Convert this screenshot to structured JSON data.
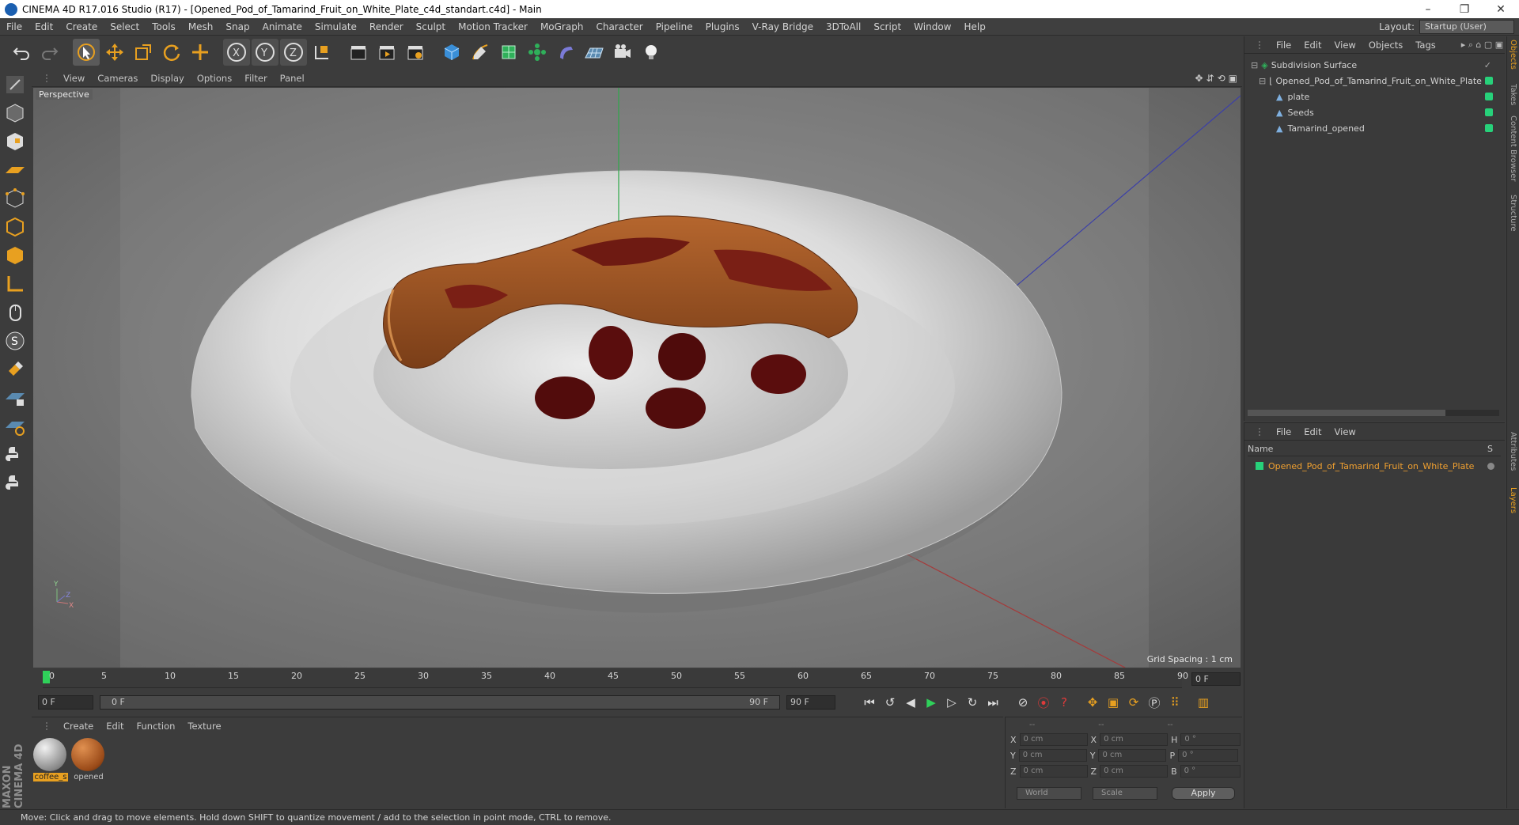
{
  "window": {
    "title": "CINEMA 4D R17.016 Studio (R17) - [Opened_Pod_of_Tamarind_Fruit_on_White_Plate_c4d_standart.c4d] - Main",
    "minimize": "–",
    "restore": "❐",
    "close": "✕"
  },
  "menubar": {
    "items": [
      "File",
      "Edit",
      "Create",
      "Select",
      "Tools",
      "Mesh",
      "Snap",
      "Animate",
      "Simulate",
      "Render",
      "Sculpt",
      "Motion Tracker",
      "MoGraph",
      "Character",
      "Pipeline",
      "Plugins",
      "V-Ray Bridge",
      "3DToAll",
      "Script",
      "Window",
      "Help"
    ],
    "layout_label": "Layout:",
    "layout_value": "Startup (User)"
  },
  "viewport": {
    "menu": [
      "View",
      "Cameras",
      "Display",
      "Options",
      "Filter",
      "Panel"
    ],
    "label": "Perspective",
    "grid_spacing": "Grid Spacing : 1 cm",
    "axis_x": "X",
    "axis_y": "Y",
    "axis_z": "Z"
  },
  "timeline": {
    "ticks": [
      "0",
      "5",
      "10",
      "15",
      "20",
      "25",
      "30",
      "35",
      "40",
      "45",
      "50",
      "55",
      "60",
      "65",
      "70",
      "75",
      "80",
      "85",
      "90"
    ],
    "current_frame": "0 F",
    "start_field": "0 F",
    "range_start": "0 F",
    "range_end": "90 F",
    "end_field": "90 F"
  },
  "materials": {
    "menu": [
      "Create",
      "Edit",
      "Function",
      "Texture"
    ],
    "items": [
      {
        "label": "coffee_s",
        "color": "#a9a9a9"
      },
      {
        "label": "opened",
        "color": "#b8642a"
      }
    ]
  },
  "coordinates": {
    "headers": [
      "--",
      "--",
      "--"
    ],
    "rows": [
      {
        "a": "X",
        "a_val": "0 cm",
        "b": "X",
        "b_val": "0 cm",
        "c": "H",
        "c_val": "0 °"
      },
      {
        "a": "Y",
        "a_val": "0 cm",
        "b": "Y",
        "b_val": "0 cm",
        "c": "P",
        "c_val": "0 °"
      },
      {
        "a": "Z",
        "a_val": "0 cm",
        "b": "Z",
        "b_val": "0 cm",
        "c": "B",
        "c_val": "0 °"
      }
    ],
    "mode1": "World",
    "mode2": "Scale",
    "apply": "Apply"
  },
  "object_manager": {
    "menu": [
      "File",
      "Edit",
      "View",
      "Objects",
      "Tags"
    ],
    "objects": [
      {
        "name": "Subdivision Surface"
      },
      {
        "name": "Opened_Pod_of_Tamarind_Fruit_on_White_Plate"
      },
      {
        "name": "plate"
      },
      {
        "name": "Seeds"
      },
      {
        "name": "Tamarind_opened"
      }
    ]
  },
  "layer_manager": {
    "menu": [
      "File",
      "Edit",
      "View"
    ],
    "col_name": "Name",
    "col_s": "S",
    "layers": [
      {
        "name": "Opened_Pod_of_Tamarind_Fruit_on_White_Plate"
      }
    ]
  },
  "right_tabs": [
    "Objects",
    "Takes",
    "Content Browser",
    "Structure",
    "Attributes",
    "Layers"
  ],
  "brand": {
    "line1": "MAXON",
    "line2": "CINEMA 4D"
  },
  "statusbar": "Move: Click and drag to move elements. Hold down SHIFT to quantize movement / add to the selection in point mode, CTRL to remove.",
  "colors": {
    "accent": "#e8a020",
    "layer_green": "#27d17a",
    "selection_orange": "#f0a030"
  }
}
